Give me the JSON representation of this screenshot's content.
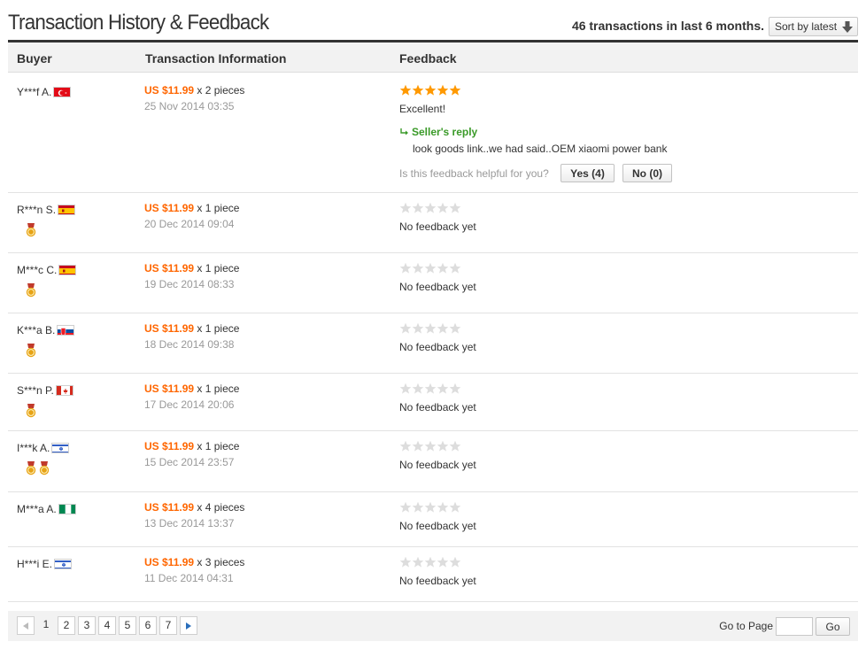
{
  "header": {
    "title": "Transaction History & Feedback",
    "summary": "46 transactions in last 6 months.",
    "sort_label": "Sort by latest"
  },
  "columns": {
    "buyer": "Buyer",
    "transaction": "Transaction Information",
    "feedback": "Feedback"
  },
  "colors": {
    "price": "#ff6600",
    "star_filled": "#ff9900",
    "star_empty": "#dddddd",
    "reply": "#3a9a28",
    "medal": "#e7a316"
  },
  "rows": [
    {
      "buyer": "Y***f A.",
      "flag": "tr",
      "medals": 0,
      "price": "US $11.99",
      "qty": "x 2 pieces",
      "date": "25 Nov 2014 03:35",
      "stars": 5,
      "feedback": "Excellent!",
      "reply_label": "Seller's reply",
      "reply_text": "look goods link..we had said..OEM xiaomi power bank",
      "helpful_label": "Is this feedback helpful for you?",
      "yes_label": "Yes (4)",
      "no_label": "No (0)"
    },
    {
      "buyer": "R***n S.",
      "flag": "es",
      "medals": 1,
      "price": "US $11.99",
      "qty": "x 1 piece",
      "date": "20 Dec 2014 09:04",
      "stars": 0,
      "feedback": "No feedback yet"
    },
    {
      "buyer": "M***c C.",
      "flag": "es",
      "medals": 1,
      "price": "US $11.99",
      "qty": "x 1 piece",
      "date": "19 Dec 2014 08:33",
      "stars": 0,
      "feedback": "No feedback yet"
    },
    {
      "buyer": "K***a B.",
      "flag": "sk",
      "medals": 1,
      "price": "US $11.99",
      "qty": "x 1 piece",
      "date": "18 Dec 2014 09:38",
      "stars": 0,
      "feedback": "No feedback yet"
    },
    {
      "buyer": "S***n P.",
      "flag": "ca",
      "medals": 1,
      "price": "US $11.99",
      "qty": "x 1 piece",
      "date": "17 Dec 2014 20:06",
      "stars": 0,
      "feedback": "No feedback yet"
    },
    {
      "buyer": "I***k A.",
      "flag": "il",
      "medals": 2,
      "price": "US $11.99",
      "qty": "x 1 piece",
      "date": "15 Dec 2014 23:57",
      "stars": 0,
      "feedback": "No feedback yet"
    },
    {
      "buyer": "M***a A.",
      "flag": "ng",
      "medals": 0,
      "price": "US $11.99",
      "qty": "x 4 pieces",
      "date": "13 Dec 2014 13:37",
      "stars": 0,
      "feedback": "No feedback yet"
    },
    {
      "buyer": "H***i E.",
      "flag": "il",
      "medals": 0,
      "price": "US $11.99",
      "qty": "x 3 pieces",
      "date": "11 Dec 2014 04:31",
      "stars": 0,
      "feedback": "No feedback yet"
    }
  ],
  "pagination": {
    "pages": [
      "1",
      "2",
      "3",
      "4",
      "5",
      "6",
      "7"
    ],
    "current": "1",
    "goto_label": "Go to Page",
    "goto_value": "",
    "go_label": "Go"
  }
}
